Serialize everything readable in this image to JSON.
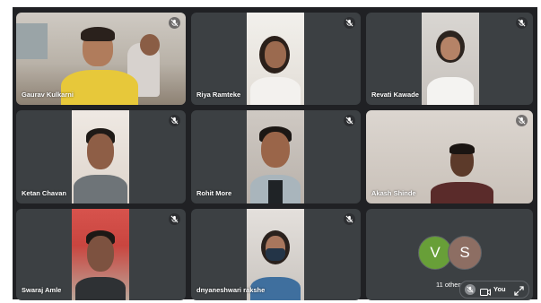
{
  "participants": [
    {
      "name": "Gaurav Kulkarni",
      "muted": true
    },
    {
      "name": "Riya Ramteke",
      "muted": true
    },
    {
      "name": "Revati Kawade",
      "muted": true
    },
    {
      "name": "Ketan Chavan",
      "muted": true
    },
    {
      "name": "Rohit More",
      "muted": true
    },
    {
      "name": "Akash Shinde",
      "muted": true
    },
    {
      "name": "Swaraj Amle",
      "muted": true
    },
    {
      "name": "dnyaneshwari rakshe",
      "muted": true
    }
  ],
  "others_tile": {
    "avatars": [
      {
        "initial": "V",
        "color": "#689f38"
      },
      {
        "initial": "S",
        "color": "#8d6e63"
      }
    ],
    "label": "11 others",
    "self": {
      "label": "You"
    }
  },
  "colors": {
    "stage_background": "#202124",
    "tile_background": "#3c4043"
  },
  "icons": [
    "mic-off-icon",
    "camera-icon",
    "expand-icon"
  ]
}
